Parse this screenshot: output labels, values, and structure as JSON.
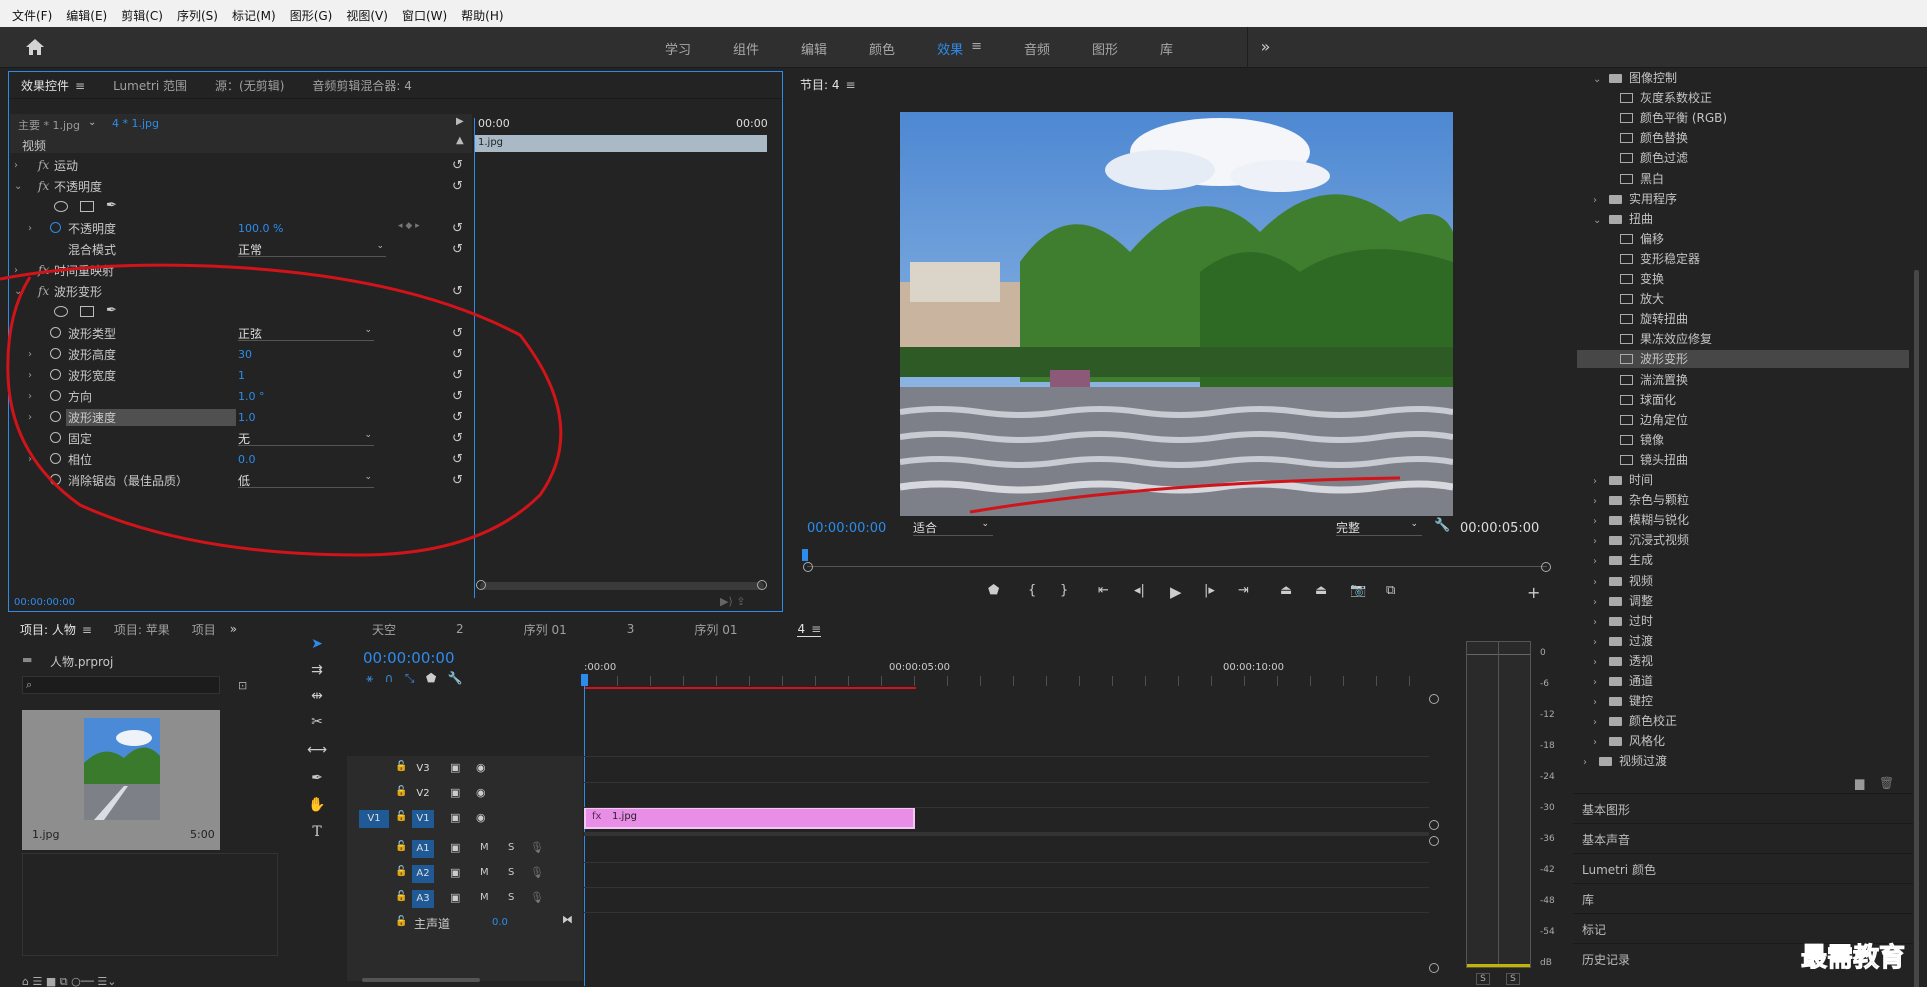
{
  "menu": [
    "文件(F)",
    "编辑(E)",
    "剪辑(C)",
    "序列(S)",
    "标记(M)",
    "图形(G)",
    "视图(V)",
    "窗口(W)",
    "帮助(H)"
  ],
  "workspaces": {
    "tabs": [
      "学习",
      "组件",
      "编辑",
      "颜色",
      "效果",
      "音频",
      "图形",
      "库"
    ],
    "active": "效果",
    "more": "»"
  },
  "effect_controls": {
    "tabs": [
      "效果控件",
      "Lumetri 范围",
      "源：(无剪辑)",
      "音频剪辑混合器: 4"
    ],
    "master": "主要 * 1.jpg",
    "clip": "4 * 1.jpg",
    "tc_start": "00:00",
    "tc_end": "00:00",
    "clip_bar": "1.jpg",
    "section": "视频",
    "rows": {
      "motion": "运动",
      "opacity": "不透明度",
      "opacity_param": "不透明度",
      "opacity_val": "100.0 %",
      "blend": "混合模式",
      "blend_val": "正常",
      "time_remap": "时间重映射",
      "wave": "波形变形",
      "wave_type": "波形类型",
      "wave_type_val": "正弦",
      "wave_height": "波形高度",
      "wave_height_val": "30",
      "wave_width": "波形宽度",
      "wave_width_val": "1",
      "direction": "方向",
      "direction_val": "1.0 °",
      "wave_speed": "波形速度",
      "wave_speed_val": "1.0",
      "pin": "固定",
      "pin_val": "无",
      "phase": "相位",
      "phase_val": "0.0",
      "antialias": "消除锯齿（最佳品质）",
      "antialias_val": "低"
    },
    "timecode": "00:00:00:00"
  },
  "program": {
    "title": "节目: 4",
    "timecode": "00:00:00:00",
    "fit": "适合",
    "quality": "完整",
    "duration": "00:00:05:00"
  },
  "effects_tree": {
    "items": [
      "图像控制",
      "灰度系数校正",
      "颜色平衡 (RGB)",
      "颜色替换",
      "颜色过滤",
      "黑白",
      "实用程序",
      "扭曲",
      "偏移",
      "变形稳定器",
      "变换",
      "放大",
      "旋转扭曲",
      "果冻效应修复",
      "波形变形",
      "湍流置换",
      "球面化",
      "边角定位",
      "镜像",
      "镜头扭曲",
      "时间",
      "杂色与颗粒",
      "模糊与锐化",
      "沉浸式视频",
      "生成",
      "视频",
      "调整",
      "过时",
      "过渡",
      "透视",
      "通道",
      "键控",
      "颜色校正",
      "风格化",
      "视频过渡"
    ],
    "selected": "波形变形"
  },
  "side_panels": [
    "基本图形",
    "基本声音",
    "Lumetri 颜色",
    "库",
    "标记",
    "历史记录"
  ],
  "project": {
    "tabs": [
      "项目: 人物",
      "项目: 苹果",
      "项目"
    ],
    "file": "人物.prproj",
    "search_placeholder": "",
    "thumb_name": "1.jpg",
    "thumb_duration": "5:00"
  },
  "timeline": {
    "tabs": [
      "天空",
      "2",
      "序列 01",
      "3",
      "序列 01",
      "4"
    ],
    "active_tab": "4",
    "timecode": "00:00:00:00",
    "ruler": [
      ":00:00",
      "00:00:05:00",
      "00:00:10:00"
    ],
    "video_tracks": [
      "V3",
      "V2",
      "V1"
    ],
    "audio_tracks": [
      "A1",
      "A2",
      "A3"
    ],
    "source_patch": "V1",
    "master": "主声道",
    "master_val": "0.0",
    "clip": "1.jpg",
    "m": "M",
    "s": "S"
  },
  "meter": {
    "labels": [
      "0",
      "-6",
      "-12",
      "-18",
      "-24",
      "-30",
      "-36",
      "-42",
      "-48",
      "-54",
      "dB"
    ],
    "solo": [
      "S",
      "S"
    ]
  },
  "watermark": "最需教育",
  "colors": {
    "accent": "#2d8ceb",
    "clip_pink": "#e98ee6",
    "annotation_red": "#d0141a"
  }
}
